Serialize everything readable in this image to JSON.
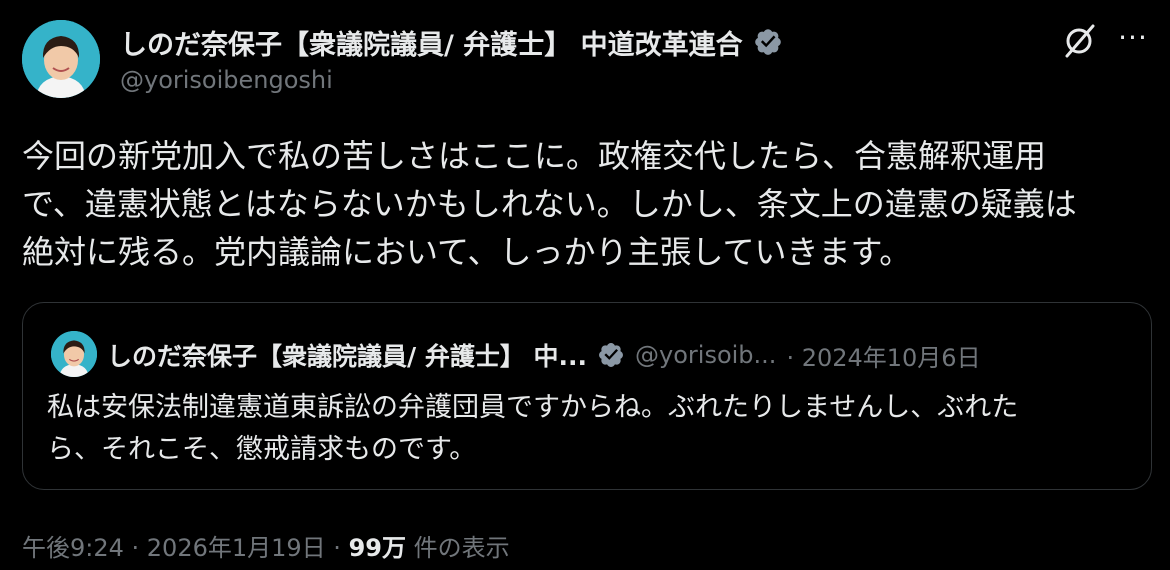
{
  "author": {
    "name": "しのだ奈保子【衆議院議員/ 弁護士】 中道改革連合",
    "handle": "@yorisoibengoshi"
  },
  "post": {
    "text": "今回の新党加入で私の苦しさはここに。政権交代したら、合憲解釈運用\nで、違憲状態とはならないかもしれない。しかし、条文上の違憲の疑義は\n絶対に残る。党内議論において、しっかり主張していきます。"
  },
  "quoted_post": {
    "name": "しのだ奈保子【衆議院議員/ 弁護士】 中...",
    "handle": "@yorisoib...",
    "date": "· 2024年10月6日",
    "text": "私は安保法制違憲道東訴訟の弁護団員ですからね。ぶれたりしませんし、ぶれた\nら、それこそ、懲戒請求ものです。"
  },
  "meta": {
    "time": "午後9:24 · 2026年1月19日 · ",
    "views_count": "99万",
    "views_label": " 件の表示"
  },
  "icons": {
    "verified": "verified-badge-icon",
    "grok": "grok-icon",
    "more": "more-icon"
  },
  "colors": {
    "background": "#000000",
    "text": "#e7e9ea",
    "secondary": "#71767b",
    "border": "#2f3336",
    "avatar_bg": "#35b3c9"
  }
}
